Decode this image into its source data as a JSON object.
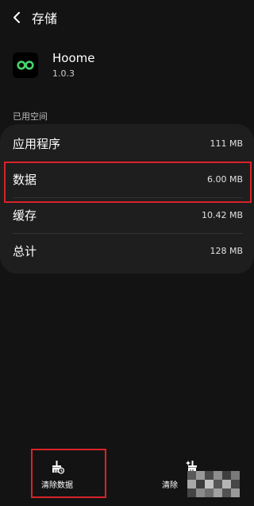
{
  "header": {
    "title": "存储"
  },
  "app": {
    "name": "Hoome",
    "version": "1.0.3"
  },
  "section": {
    "label": "已用空间"
  },
  "storage_rows": [
    {
      "label": "应用程序",
      "value": "111 MB"
    },
    {
      "label": "数据",
      "value": "6.00 MB"
    },
    {
      "label": "缓存",
      "value": "10.42 MB"
    },
    {
      "label": "总计",
      "value": "128 MB"
    }
  ],
  "actions": {
    "clear_data_label": "清除数据",
    "clear_cache_label": "清除"
  },
  "colors": {
    "background": "#131313",
    "card": "#1e1e1e",
    "highlight": "#d8232a",
    "app_icon_accent": "#46d36a"
  },
  "icons": {
    "back": "back-arrow-icon",
    "app": "infinity-logo-icon",
    "clear_data": "broom-clear-data-icon",
    "clear_cache": "broom-clear-cache-icon"
  }
}
